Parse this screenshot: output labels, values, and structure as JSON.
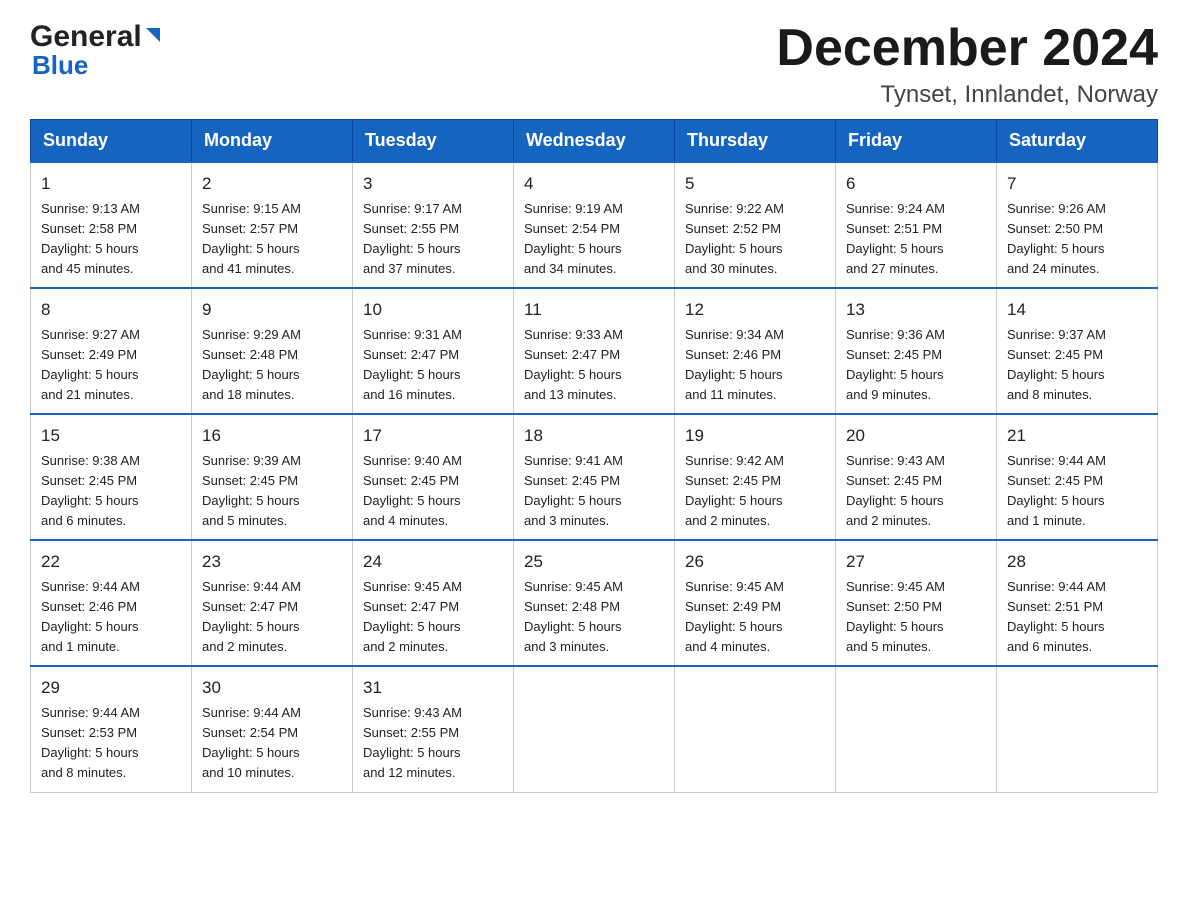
{
  "logo": {
    "general": "General",
    "blue": "Blue"
  },
  "title": {
    "month_year": "December 2024",
    "location": "Tynset, Innlandet, Norway"
  },
  "headers": [
    "Sunday",
    "Monday",
    "Tuesday",
    "Wednesday",
    "Thursday",
    "Friday",
    "Saturday"
  ],
  "weeks": [
    [
      {
        "day": "1",
        "sunrise": "9:13 AM",
        "sunset": "2:58 PM",
        "daylight": "5 hours and 45 minutes."
      },
      {
        "day": "2",
        "sunrise": "9:15 AM",
        "sunset": "2:57 PM",
        "daylight": "5 hours and 41 minutes."
      },
      {
        "day": "3",
        "sunrise": "9:17 AM",
        "sunset": "2:55 PM",
        "daylight": "5 hours and 37 minutes."
      },
      {
        "day": "4",
        "sunrise": "9:19 AM",
        "sunset": "2:54 PM",
        "daylight": "5 hours and 34 minutes."
      },
      {
        "day": "5",
        "sunrise": "9:22 AM",
        "sunset": "2:52 PM",
        "daylight": "5 hours and 30 minutes."
      },
      {
        "day": "6",
        "sunrise": "9:24 AM",
        "sunset": "2:51 PM",
        "daylight": "5 hours and 27 minutes."
      },
      {
        "day": "7",
        "sunrise": "9:26 AM",
        "sunset": "2:50 PM",
        "daylight": "5 hours and 24 minutes."
      }
    ],
    [
      {
        "day": "8",
        "sunrise": "9:27 AM",
        "sunset": "2:49 PM",
        "daylight": "5 hours and 21 minutes."
      },
      {
        "day": "9",
        "sunrise": "9:29 AM",
        "sunset": "2:48 PM",
        "daylight": "5 hours and 18 minutes."
      },
      {
        "day": "10",
        "sunrise": "9:31 AM",
        "sunset": "2:47 PM",
        "daylight": "5 hours and 16 minutes."
      },
      {
        "day": "11",
        "sunrise": "9:33 AM",
        "sunset": "2:47 PM",
        "daylight": "5 hours and 13 minutes."
      },
      {
        "day": "12",
        "sunrise": "9:34 AM",
        "sunset": "2:46 PM",
        "daylight": "5 hours and 11 minutes."
      },
      {
        "day": "13",
        "sunrise": "9:36 AM",
        "sunset": "2:45 PM",
        "daylight": "5 hours and 9 minutes."
      },
      {
        "day": "14",
        "sunrise": "9:37 AM",
        "sunset": "2:45 PM",
        "daylight": "5 hours and 8 minutes."
      }
    ],
    [
      {
        "day": "15",
        "sunrise": "9:38 AM",
        "sunset": "2:45 PM",
        "daylight": "5 hours and 6 minutes."
      },
      {
        "day": "16",
        "sunrise": "9:39 AM",
        "sunset": "2:45 PM",
        "daylight": "5 hours and 5 minutes."
      },
      {
        "day": "17",
        "sunrise": "9:40 AM",
        "sunset": "2:45 PM",
        "daylight": "5 hours and 4 minutes."
      },
      {
        "day": "18",
        "sunrise": "9:41 AM",
        "sunset": "2:45 PM",
        "daylight": "5 hours and 3 minutes."
      },
      {
        "day": "19",
        "sunrise": "9:42 AM",
        "sunset": "2:45 PM",
        "daylight": "5 hours and 2 minutes."
      },
      {
        "day": "20",
        "sunrise": "9:43 AM",
        "sunset": "2:45 PM",
        "daylight": "5 hours and 2 minutes."
      },
      {
        "day": "21",
        "sunrise": "9:44 AM",
        "sunset": "2:45 PM",
        "daylight": "5 hours and 1 minute."
      }
    ],
    [
      {
        "day": "22",
        "sunrise": "9:44 AM",
        "sunset": "2:46 PM",
        "daylight": "5 hours and 1 minute."
      },
      {
        "day": "23",
        "sunrise": "9:44 AM",
        "sunset": "2:47 PM",
        "daylight": "5 hours and 2 minutes."
      },
      {
        "day": "24",
        "sunrise": "9:45 AM",
        "sunset": "2:47 PM",
        "daylight": "5 hours and 2 minutes."
      },
      {
        "day": "25",
        "sunrise": "9:45 AM",
        "sunset": "2:48 PM",
        "daylight": "5 hours and 3 minutes."
      },
      {
        "day": "26",
        "sunrise": "9:45 AM",
        "sunset": "2:49 PM",
        "daylight": "5 hours and 4 minutes."
      },
      {
        "day": "27",
        "sunrise": "9:45 AM",
        "sunset": "2:50 PM",
        "daylight": "5 hours and 5 minutes."
      },
      {
        "day": "28",
        "sunrise": "9:44 AM",
        "sunset": "2:51 PM",
        "daylight": "5 hours and 6 minutes."
      }
    ],
    [
      {
        "day": "29",
        "sunrise": "9:44 AM",
        "sunset": "2:53 PM",
        "daylight": "5 hours and 8 minutes."
      },
      {
        "day": "30",
        "sunrise": "9:44 AM",
        "sunset": "2:54 PM",
        "daylight": "5 hours and 10 minutes."
      },
      {
        "day": "31",
        "sunrise": "9:43 AM",
        "sunset": "2:55 PM",
        "daylight": "5 hours and 12 minutes."
      },
      null,
      null,
      null,
      null
    ]
  ],
  "labels": {
    "sunrise": "Sunrise: ",
    "sunset": "Sunset: ",
    "daylight": "Daylight: "
  }
}
